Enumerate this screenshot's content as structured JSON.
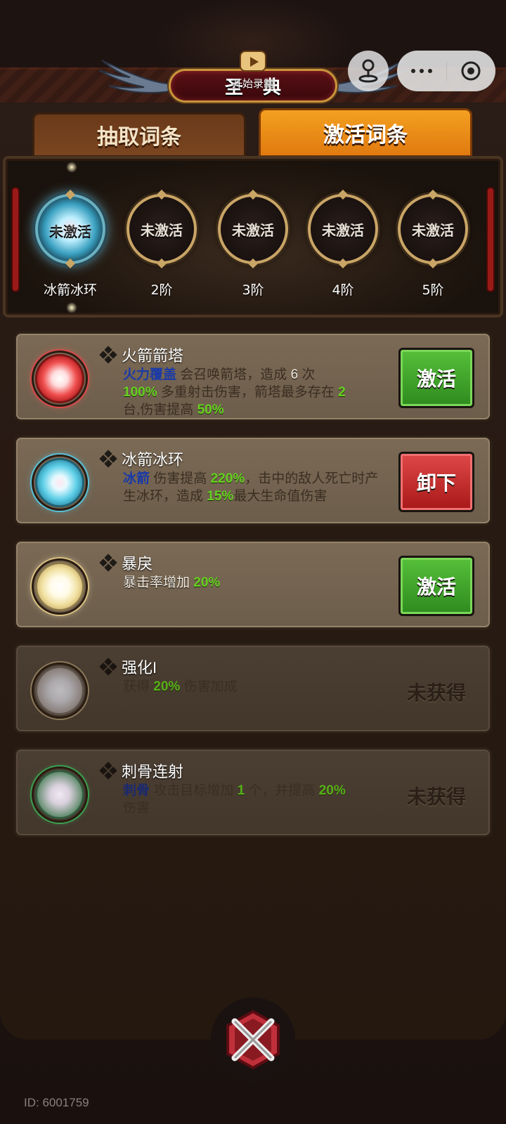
{
  "header": {
    "title": "圣典",
    "record_label": "开始录制",
    "menu_icon": "ellipsis-icon",
    "close_icon": "target-icon"
  },
  "tabs": [
    {
      "label": "抽取词条",
      "active": false
    },
    {
      "label": "激活词条",
      "active": true
    }
  ],
  "slots": [
    {
      "text": "未激活",
      "label": "冰箭冰环",
      "active": true
    },
    {
      "text": "未激活",
      "label": "2阶",
      "active": false
    },
    {
      "text": "未激活",
      "label": "3阶",
      "active": false
    },
    {
      "text": "未激活",
      "label": "4阶",
      "active": false
    },
    {
      "text": "未激活",
      "label": "5阶",
      "active": false
    }
  ],
  "cards": [
    {
      "title": "火箭箭塔",
      "orb_color": "red",
      "desc": {
        "kw": "火力覆盖",
        "t1": " 会召唤箭塔，造成 ",
        "n1": "6",
        "t2": " 次",
        "n2": "100%",
        "t3": " 多重射击伤害，箭塔最多存在 ",
        "n3": "2",
        "t4": "台,伤害提高 ",
        "n4": "50%"
      },
      "button": "激活",
      "button_color": "#3aa82a"
    },
    {
      "title": "冰箭冰环",
      "orb_color": "cyan",
      "desc": {
        "kw": "冰箭",
        "t1": " 伤害提高 ",
        "n1": "220%",
        "t2": "，击中的敌人死亡时产生冰环，造成 ",
        "n2": "15%",
        "t3": "最大生命值伤害"
      },
      "button": "卸下",
      "button_color": "#c42222"
    },
    {
      "title": "暴戾",
      "orb_color": "gold",
      "desc": {
        "t1": "暴击率增加 ",
        "n1": "20%"
      },
      "button": "激活",
      "button_color": "#3aa82a"
    },
    {
      "title": "强化I",
      "orb_color": "grey",
      "desc": {
        "t1": "获得 ",
        "n1": "20%",
        "t2": " 伤害加成"
      },
      "status": "未获得"
    },
    {
      "title": "刺骨连射",
      "orb_color": "green",
      "desc": {
        "kw": "刺骨",
        "t1": " 攻击目标增加 ",
        "n1": "1",
        "t2": " 个，并提高 ",
        "n2": "20%",
        "t3": "伤害"
      },
      "status": "未获得"
    }
  ],
  "footer": {
    "id_text": "ID: 6001759",
    "close_icon": "crossed-swords-close-icon"
  }
}
